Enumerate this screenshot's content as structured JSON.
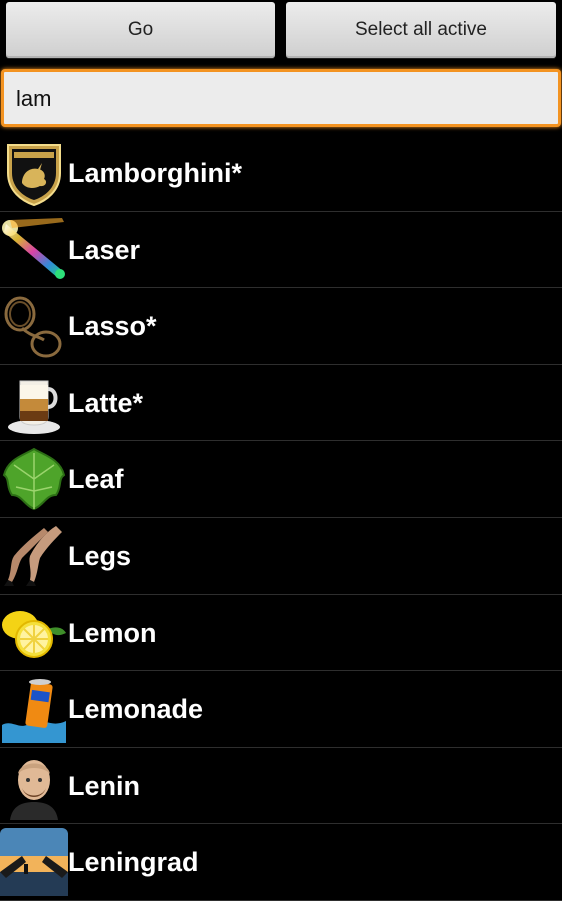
{
  "toolbar": {
    "go_label": "Go",
    "select_all_label": "Select all active"
  },
  "search": {
    "value": "lam"
  },
  "items": [
    {
      "label": "Lamborghini*",
      "icon": "lamborghini-logo-icon"
    },
    {
      "label": "Laser",
      "icon": "laser-icon"
    },
    {
      "label": "Lasso*",
      "icon": "lasso-icon"
    },
    {
      "label": "Latte*",
      "icon": "latte-icon"
    },
    {
      "label": "Leaf",
      "icon": "leaf-icon"
    },
    {
      "label": "Legs",
      "icon": "legs-icon"
    },
    {
      "label": "Lemon",
      "icon": "lemon-icon"
    },
    {
      "label": "Lemonade",
      "icon": "lemonade-icon"
    },
    {
      "label": "Lenin",
      "icon": "lenin-icon"
    },
    {
      "label": "Leningrad",
      "icon": "leningrad-icon"
    }
  ],
  "colors": {
    "accent": "#f39321",
    "background": "#000000",
    "button": "#dcdcdc"
  }
}
